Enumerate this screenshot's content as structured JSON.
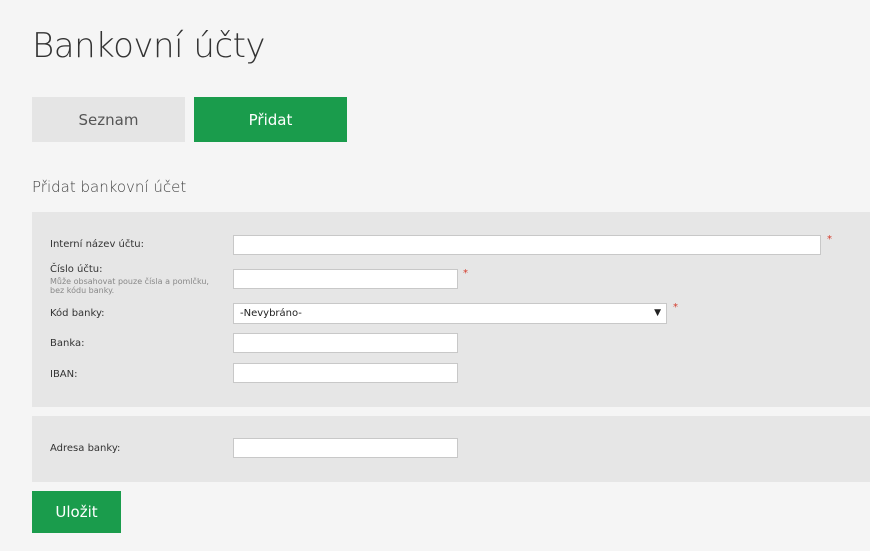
{
  "page": {
    "title": "Bankovní účty"
  },
  "tabs": {
    "list_label": "Seznam",
    "add_label": "Přidat"
  },
  "form": {
    "section_title": "Přidat bankovní účet",
    "required_mark": "*",
    "fields": {
      "internal_name": {
        "label": "Interní název účtu:",
        "value": ""
      },
      "account_number": {
        "label": "Číslo účtu:",
        "hint": "Může obsahovat pouze čísla a pomlčku, bez kódu banky.",
        "value": ""
      },
      "bank_code": {
        "label": "Kód banky:",
        "selected": "-Nevybráno-"
      },
      "bank": {
        "label": "Banka:",
        "value": ""
      },
      "iban": {
        "label": "IBAN:",
        "value": ""
      },
      "bank_address": {
        "label": "Adresa banky:",
        "value": ""
      }
    },
    "save_label": "Uložit"
  },
  "icons": {
    "dropdown": "caret-down-icon"
  },
  "colors": {
    "accent": "#1a9c4c",
    "tab_inactive_bg": "#e5e5e5",
    "panel_bg": "#e6e6e6",
    "page_bg": "#f5f5f5",
    "required": "#d43a2a"
  }
}
